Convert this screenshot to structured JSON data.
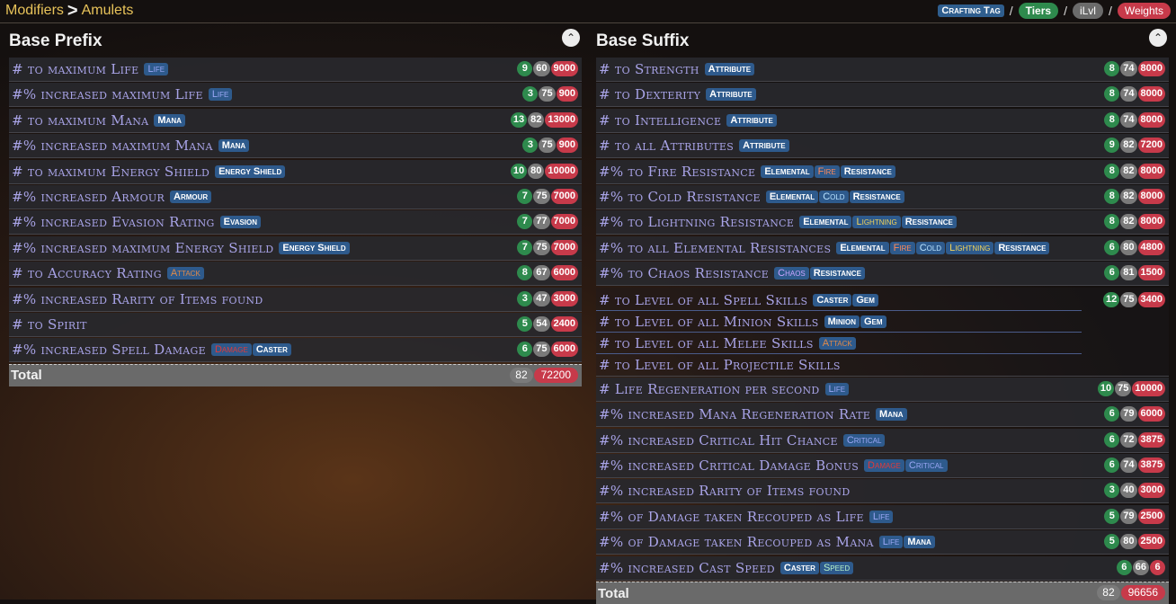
{
  "breadcrumb": {
    "root": "Modifiers",
    "sep": ">",
    "current": "Amulets"
  },
  "legend": {
    "tag": "Crafting Tag",
    "tiers": "Tiers",
    "ilvl": "iLvl",
    "weights": "Weights",
    "slash": "/"
  },
  "prefix": {
    "title": "Base Prefix",
    "total_label": "Total",
    "total_ilvl": "82",
    "total_weight": "72200",
    "rows": [
      {
        "text": "# to maximum Life",
        "tags": [
          {
            "label": "Life",
            "cls": "life"
          }
        ],
        "t": "9",
        "i": "60",
        "w": "9000"
      },
      {
        "text": "#% increased maximum Life",
        "tags": [
          {
            "label": "Life",
            "cls": "life"
          }
        ],
        "t": "3",
        "i": "75",
        "w": "900"
      },
      {
        "text": "# to maximum Mana",
        "tags": [
          {
            "label": "Mana",
            "cls": ""
          }
        ],
        "t": "13",
        "i": "82",
        "w": "13000"
      },
      {
        "text": "#% increased maximum Mana",
        "tags": [
          {
            "label": "Mana",
            "cls": ""
          }
        ],
        "t": "3",
        "i": "75",
        "w": "900"
      },
      {
        "text": "# to maximum Energy Shield",
        "tags": [
          {
            "label": "Energy Shield",
            "cls": ""
          }
        ],
        "t": "10",
        "i": "80",
        "w": "10000"
      },
      {
        "text": "#% increased Armour",
        "tags": [
          {
            "label": "Armour",
            "cls": ""
          }
        ],
        "t": "7",
        "i": "75",
        "w": "7000"
      },
      {
        "text": "#% increased Evasion Rating",
        "tags": [
          {
            "label": "Evasion",
            "cls": ""
          }
        ],
        "t": "7",
        "i": "77",
        "w": "7000"
      },
      {
        "text": "#% increased maximum Energy Shield",
        "tags": [
          {
            "label": "Energy Shield",
            "cls": ""
          }
        ],
        "t": "7",
        "i": "75",
        "w": "7000"
      },
      {
        "text": "# to Accuracy Rating",
        "tags": [
          {
            "label": "Attack",
            "cls": "attack"
          }
        ],
        "t": "8",
        "i": "67",
        "w": "6000"
      },
      {
        "text": "#% increased Rarity of Items found",
        "tags": [],
        "t": "3",
        "i": "47",
        "w": "3000"
      },
      {
        "text": "# to Spirit",
        "tags": [],
        "t": "5",
        "i": "54",
        "w": "2400"
      },
      {
        "text": "#% increased Spell Damage",
        "tags": [
          {
            "label": "Damage",
            "cls": "damage"
          },
          {
            "label": "Caster",
            "cls": ""
          }
        ],
        "t": "6",
        "i": "75",
        "w": "6000"
      }
    ]
  },
  "suffix": {
    "title": "Base Suffix",
    "total_label": "Total",
    "total_ilvl": "82",
    "total_weight": "96656",
    "rows": [
      {
        "text": "# to Strength",
        "tags": [
          {
            "label": "Attribute",
            "cls": ""
          }
        ],
        "t": "8",
        "i": "74",
        "w": "8000"
      },
      {
        "text": "# to Dexterity",
        "tags": [
          {
            "label": "Attribute",
            "cls": ""
          }
        ],
        "t": "8",
        "i": "74",
        "w": "8000"
      },
      {
        "text": "# to Intelligence",
        "tags": [
          {
            "label": "Attribute",
            "cls": ""
          }
        ],
        "t": "8",
        "i": "74",
        "w": "8000"
      },
      {
        "text": "# to all Attributes",
        "tags": [
          {
            "label": "Attribute",
            "cls": ""
          }
        ],
        "t": "9",
        "i": "82",
        "w": "7200"
      },
      {
        "text": "#% to Fire Resistance",
        "tags": [
          {
            "label": "Elemental",
            "cls": ""
          },
          {
            "label": "Fire",
            "cls": "fire"
          },
          {
            "label": "Resistance",
            "cls": ""
          }
        ],
        "t": "8",
        "i": "82",
        "w": "8000"
      },
      {
        "text": "#% to Cold Resistance",
        "tags": [
          {
            "label": "Elemental",
            "cls": ""
          },
          {
            "label": "Cold",
            "cls": "cold"
          },
          {
            "label": "Resistance",
            "cls": ""
          }
        ],
        "t": "8",
        "i": "82",
        "w": "8000"
      },
      {
        "text": "#% to Lightning Resistance",
        "tags": [
          {
            "label": "Elemental",
            "cls": ""
          },
          {
            "label": "Lightning",
            "cls": "lightning"
          },
          {
            "label": "Resistance",
            "cls": ""
          }
        ],
        "t": "8",
        "i": "82",
        "w": "8000"
      },
      {
        "text": "#% to all Elemental Resistances",
        "tags": [
          {
            "label": "Elemental",
            "cls": ""
          },
          {
            "label": "Fire",
            "cls": "fire"
          },
          {
            "label": "Cold",
            "cls": "cold"
          },
          {
            "label": "Lightning",
            "cls": "lightning"
          },
          {
            "label": "Resistance",
            "cls": ""
          }
        ],
        "t": "6",
        "i": "80",
        "w": "4800"
      },
      {
        "text": "#% to Chaos Resistance",
        "tags": [
          {
            "label": "Chaos",
            "cls": "chaos"
          },
          {
            "label": "Resistance",
            "cls": ""
          }
        ],
        "t": "6",
        "i": "81",
        "w": "1500"
      }
    ],
    "skill_group": {
      "t": "12",
      "i": "75",
      "w": "3400",
      "lines": [
        {
          "text": "# to Level of all Spell Skills",
          "tags": [
            {
              "label": "Caster",
              "cls": ""
            },
            {
              "label": "Gem",
              "cls": ""
            }
          ]
        },
        {
          "text": "# to Level of all Minion Skills",
          "tags": [
            {
              "label": "Minion",
              "cls": ""
            },
            {
              "label": "Gem",
              "cls": ""
            }
          ]
        },
        {
          "text": "# to Level of all Melee Skills",
          "tags": [
            {
              "label": "Attack",
              "cls": "attack"
            }
          ]
        },
        {
          "text": "# to Level of all Projectile Skills",
          "tags": []
        }
      ]
    },
    "rows2": [
      {
        "text": "# Life Regeneration per second",
        "tags": [
          {
            "label": "Life",
            "cls": "life"
          }
        ],
        "t": "10",
        "i": "75",
        "w": "10000"
      },
      {
        "text": "#% increased Mana Regeneration Rate",
        "tags": [
          {
            "label": "Mana",
            "cls": ""
          }
        ],
        "t": "6",
        "i": "79",
        "w": "6000"
      },
      {
        "text": "#% increased Critical Hit Chance",
        "tags": [
          {
            "label": "Critical",
            "cls": "life"
          }
        ],
        "t": "6",
        "i": "72",
        "w": "3875"
      },
      {
        "text": "#% increased Critical Damage Bonus",
        "tags": [
          {
            "label": "Damage",
            "cls": "damage"
          },
          {
            "label": "Critical",
            "cls": "life"
          }
        ],
        "t": "6",
        "i": "74",
        "w": "3875"
      },
      {
        "text": "#% increased Rarity of Items found",
        "tags": [],
        "t": "3",
        "i": "40",
        "w": "3000"
      },
      {
        "text": "#% of Damage taken Recouped as Life",
        "tags": [
          {
            "label": "Life",
            "cls": "life"
          }
        ],
        "t": "5",
        "i": "79",
        "w": "2500"
      },
      {
        "text": "#% of Damage taken Recouped as Mana",
        "tags": [
          {
            "label": "Life",
            "cls": "life"
          },
          {
            "label": "Mana",
            "cls": ""
          }
        ],
        "t": "5",
        "i": "80",
        "w": "2500"
      },
      {
        "text": "#% increased Cast Speed",
        "tags": [
          {
            "label": "Caster",
            "cls": ""
          },
          {
            "label": "Speed",
            "cls": "speed"
          }
        ],
        "t": "6",
        "i": "66",
        "w": "6"
      }
    ]
  }
}
